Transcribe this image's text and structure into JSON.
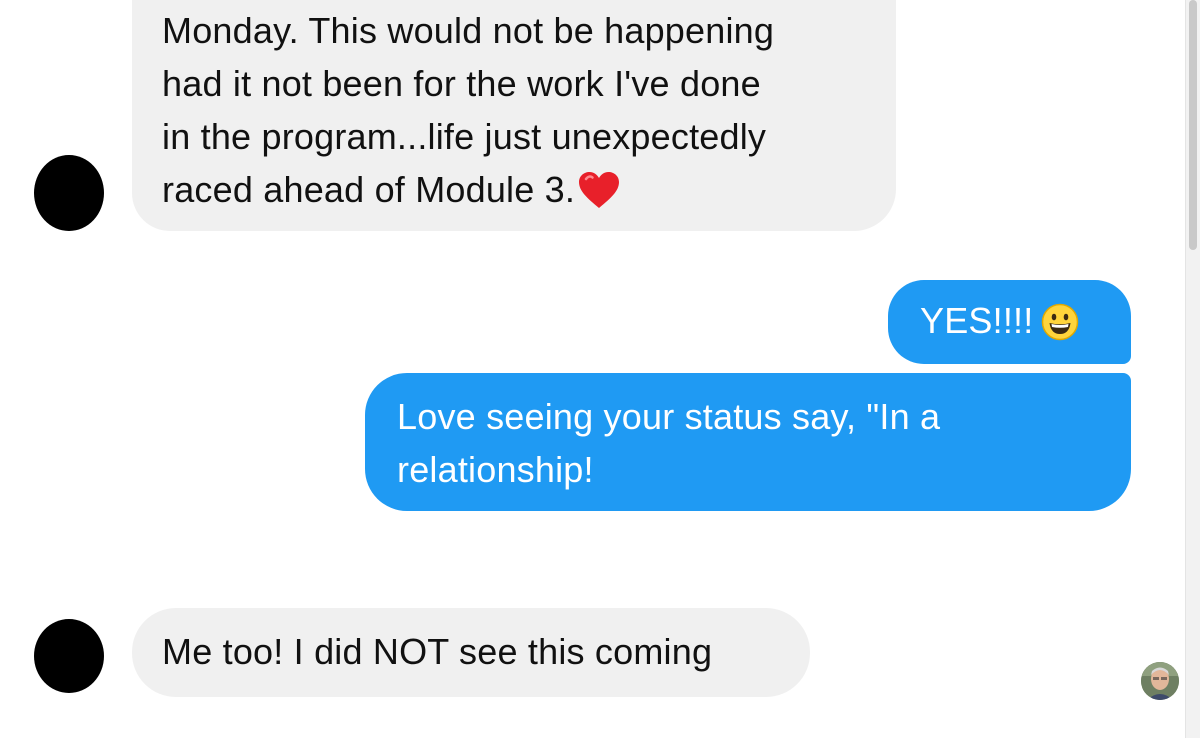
{
  "conversation": {
    "messages": [
      {
        "direction": "received",
        "lines": [
          "Monday. This would not be happening",
          "had it not been for the work I've done",
          "in the program...life just unexpectedly",
          "raced ahead of Module 3."
        ],
        "emoji": "heart-icon"
      },
      {
        "direction": "sent",
        "text": "YES!!!!",
        "emoji": "grinning-face-icon"
      },
      {
        "direction": "sent",
        "lines": [
          "Love seeing your status say, \"In a",
          "relationship!"
        ]
      },
      {
        "direction": "received",
        "text": "Me too! I did NOT see this coming"
      }
    ]
  },
  "colors": {
    "sent_bubble": "#1f9af3",
    "received_bubble": "#f0f0f0",
    "received_text": "#111111",
    "sent_text": "#ffffff",
    "heart": "#e8202a"
  }
}
